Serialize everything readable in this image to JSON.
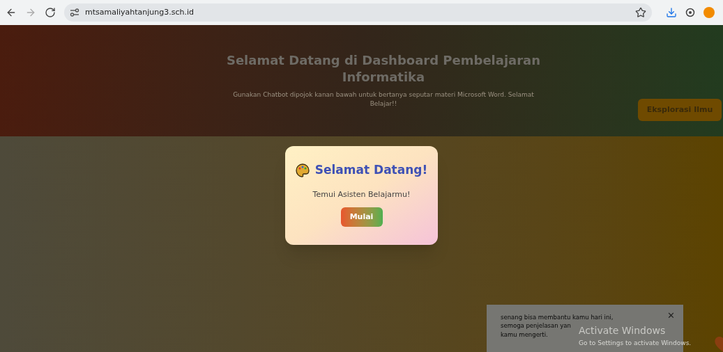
{
  "browser": {
    "url": "mtsamaliyahtanjung3.sch.id"
  },
  "header": {
    "title": "Selamat Datang di Dashboard Pembelajaran Informatika",
    "subtitle": "Gunakan Chatbot dipojok kanan bawah untuk bertanya seputar materi Microsoft Word. Selamat Belajar!!",
    "button": "Eksplorasi Ilmu"
  },
  "modal": {
    "title": "Selamat Datang!",
    "message": "Temui Asisten Belajarmu!",
    "button": "Mulai"
  },
  "chat_bubble": {
    "lines": [
      "senang bisa membantu kamu hari ini,",
      "semoga penjelasan yan",
      "kamu mengerti."
    ],
    "close": "✕"
  },
  "os_notice": {
    "title": "Activate Windows",
    "subtitle": "Go to Settings to activate Windows."
  }
}
